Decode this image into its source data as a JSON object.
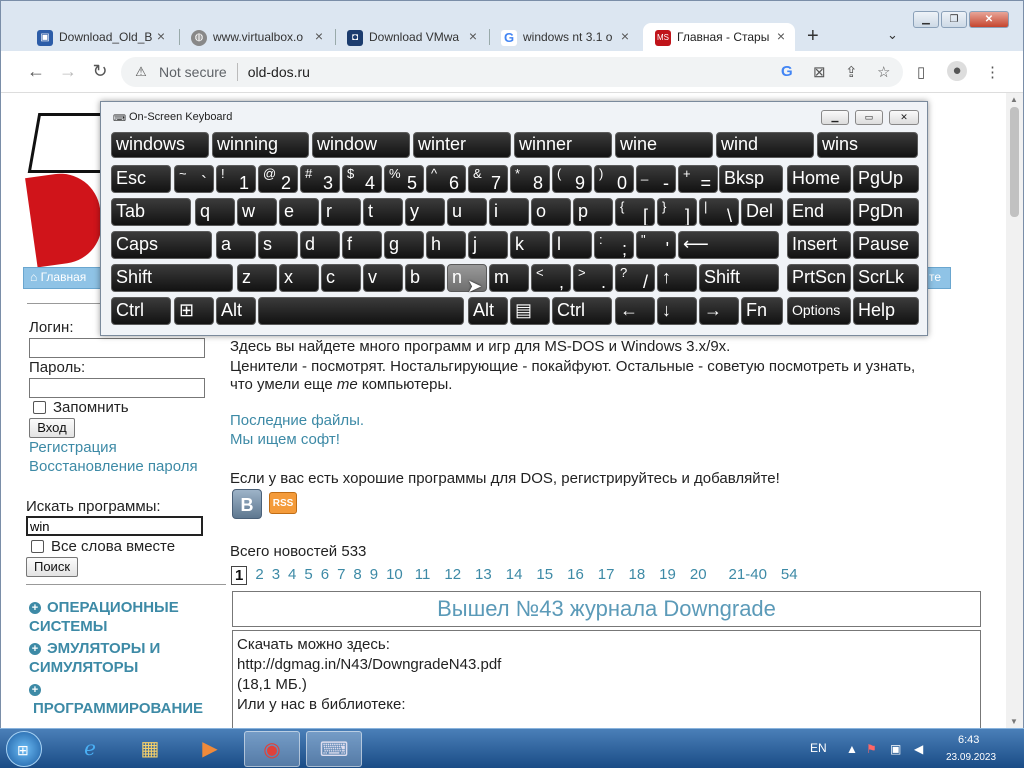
{
  "browser": {
    "tabs": [
      {
        "title": "Download_Old_B",
        "favicon": "vbox-icon",
        "color": "#2d5da8"
      },
      {
        "title": "www.virtualbox.o",
        "favicon": "globe-icon",
        "color": "#666666"
      },
      {
        "title": "Download VMwa",
        "favicon": "vmware-icon",
        "color": "#1c3c6e"
      },
      {
        "title": "windows nt 3.1 o",
        "favicon": "google-icon",
        "color": "#4285f4"
      },
      {
        "title": "Главная - Стары",
        "favicon": "msdos-icon",
        "color": "#c0141a",
        "active": true
      }
    ],
    "new_tab": "+",
    "omnibox": {
      "security": "Not secure",
      "url": "old-dos.ru"
    }
  },
  "page": {
    "nav": {
      "home": "Главная",
      "right_fragment": "те"
    },
    "login": {
      "login_label": "Логин:",
      "password_label": "Пароль:",
      "remember": "Запомнить",
      "submit": "Вход",
      "register": "Регистрация",
      "restore": "Восстановление пароля"
    },
    "search": {
      "label": "Искать программы:",
      "value": "win",
      "all_words": "Все слова вместе",
      "submit": "Поиск"
    },
    "categories": [
      "ОПЕРАЦИОННЫЕ СИСТЕМЫ",
      "ЭМУЛЯТОРЫ И СИМУЛЯТОРЫ",
      "ПРОГРАММИРОВАНИЕ"
    ],
    "intro": {
      "line1": "Здесь вы найдете много программ и игр для MS-DOS и Windows 3.x/9x.",
      "line2": "Ценители - посмотрят. Ностальгирующие - покайфуют. Остальные - советую посмотреть и узнать,",
      "line3a": "что умели еще ",
      "line3b": "те",
      "line3c": " компьютеры.",
      "last_files": "Последние файлы.",
      "looking": "Мы ищем софт!",
      "register_call": "Если у вас есть хорошие программы для DOS, регистрируйтесь и добавляйте!",
      "vk": "B",
      "rss": "RSS"
    },
    "news_total": "Всего новостей 533",
    "pages": [
      "1",
      "2",
      "3",
      "4",
      "5",
      "6",
      "7",
      "8",
      "9",
      "10",
      "11",
      "12",
      "13",
      "14",
      "15",
      "16",
      "17",
      "18",
      "19",
      "20",
      "21-40",
      "54"
    ],
    "news": {
      "title": "Вышел №43 журнала Downgrade",
      "l1": "Скачать можно здесь:",
      "l2": "http://dgmag.in/N43/DowngradeN43.pdf",
      "l3": "(18,1 МБ.)",
      "l4": "Или у нас в библиотеке:"
    }
  },
  "osk": {
    "title": "On-Screen Keyboard",
    "suggestions": [
      "windows",
      "winning",
      "window",
      "winter",
      "winner",
      "wine",
      "wind",
      "wins"
    ],
    "row1": [
      {
        "m": "Esc"
      },
      {
        "s": "~",
        "b": "`"
      },
      {
        "s": "!",
        "b": "1"
      },
      {
        "s": "@",
        "b": "2"
      },
      {
        "s": "#",
        "b": "3"
      },
      {
        "s": "$",
        "b": "4"
      },
      {
        "s": "%",
        "b": "5"
      },
      {
        "s": "^",
        "b": "6"
      },
      {
        "s": "&",
        "b": "7"
      },
      {
        "s": "*",
        "b": "8"
      },
      {
        "s": "(",
        "b": "9"
      },
      {
        "s": ")",
        "b": "0"
      },
      {
        "s": "_",
        "b": "-"
      },
      {
        "s": "+",
        "b": "="
      },
      {
        "m": "Bksp"
      },
      {
        "m": "Home"
      },
      {
        "m": "PgUp"
      }
    ],
    "row2": [
      {
        "m": "Tab"
      },
      {
        "m": "q"
      },
      {
        "m": "w"
      },
      {
        "m": "e"
      },
      {
        "m": "r"
      },
      {
        "m": "t"
      },
      {
        "m": "y"
      },
      {
        "m": "u"
      },
      {
        "m": "i"
      },
      {
        "m": "o"
      },
      {
        "m": "p"
      },
      {
        "s": "{",
        "b": "["
      },
      {
        "s": "}",
        "b": "]"
      },
      {
        "s": "|",
        "b": "\\"
      },
      {
        "m": "Del"
      },
      {
        "m": "End"
      },
      {
        "m": "PgDn"
      }
    ],
    "row3": [
      {
        "m": "Caps"
      },
      {
        "m": "a"
      },
      {
        "m": "s"
      },
      {
        "m": "d"
      },
      {
        "m": "f"
      },
      {
        "m": "g"
      },
      {
        "m": "h"
      },
      {
        "m": "j"
      },
      {
        "m": "k"
      },
      {
        "m": "l"
      },
      {
        "s": ":",
        "b": ";"
      },
      {
        "s": "\"",
        "b": "'"
      },
      {
        "m": "⟵"
      },
      {
        "m": "Insert"
      },
      {
        "m": "Pause"
      }
    ],
    "row4": [
      {
        "m": "Shift"
      },
      {
        "m": "z"
      },
      {
        "m": "x"
      },
      {
        "m": "c"
      },
      {
        "m": "v"
      },
      {
        "m": "b"
      },
      {
        "m": "n"
      },
      {
        "m": "m"
      },
      {
        "s": "<",
        "b": ","
      },
      {
        "s": ">",
        "b": "."
      },
      {
        "s": "?",
        "b": "/"
      },
      {
        "m": "↑"
      },
      {
        "m": "Shift"
      },
      {
        "m": "PrtScn"
      },
      {
        "m": "ScrLk"
      }
    ],
    "row5": [
      {
        "m": "Ctrl"
      },
      {
        "m": "⊞"
      },
      {
        "m": "Alt"
      },
      {
        "m": ""
      },
      {
        "m": "Alt"
      },
      {
        "m": "▤"
      },
      {
        "m": "Ctrl"
      },
      {
        "m": "←"
      },
      {
        "m": "↓"
      },
      {
        "m": "→"
      },
      {
        "m": "Fn"
      },
      {
        "m": "Options"
      },
      {
        "m": "Help"
      }
    ]
  },
  "taskbar": {
    "lang": "EN",
    "time": "6:43",
    "date": "23.09.2023"
  }
}
